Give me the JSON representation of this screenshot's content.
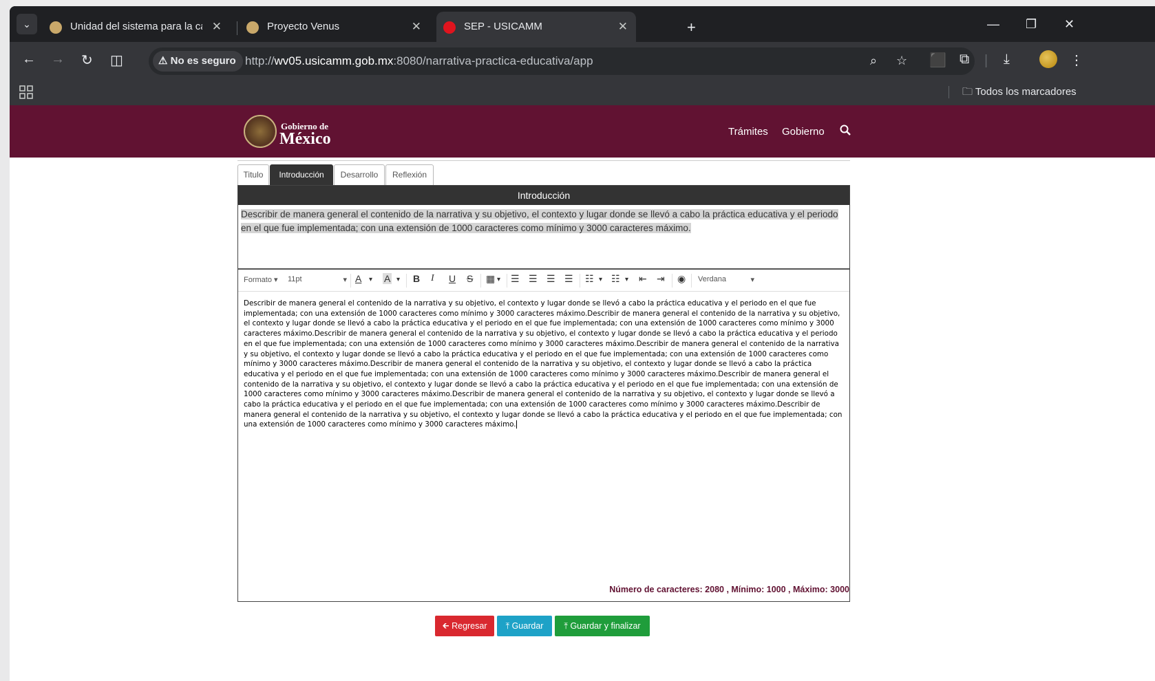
{
  "browser": {
    "tabs": [
      {
        "title": "Unidad del sistema para la carre",
        "favicon_color": "#c9a86a",
        "active": false
      },
      {
        "title": "Proyecto Venus",
        "favicon_color": "#c9a86a",
        "active": false
      },
      {
        "title": "SEP - USICAMM",
        "favicon_color": "#e0141e",
        "active": true
      }
    ],
    "security_label": "No es seguro",
    "url_scheme": "http://",
    "url_host": "wv05.usicamm.gob.mx",
    "url_path": ":8080/narrativa-practica-educativa/app",
    "bookmarks_all": "Todos los marcadores"
  },
  "gob": {
    "logo_small": "Gobierno de",
    "logo_big": "México",
    "nav": [
      "Trámites",
      "Gobierno"
    ]
  },
  "page_tabs": [
    "Titulo",
    "Introducción",
    "Desarrollo",
    "Reflexión"
  ],
  "active_tab_index": 1,
  "section_title": "Introducción",
  "instructions": "Describir de manera general el contenido de la narrativa y su objetivo, el contexto y lugar donde se llevó a cabo la práctica educativa y el periodo en el que fue implementada; con una extensión de 1000 caracteres como mínimo y 3000 caracteres máximo.",
  "editor_toolbar": {
    "format": "Formato",
    "font_size": "11pt",
    "font_family": "Verdana"
  },
  "editor_content": "Describir de manera general el contenido de la narrativa y su objetivo, el contexto y lugar donde se llevó a cabo la práctica educativa y el periodo en el que fue implementada; con una extensión de 1000 caracteres como mínimo y 3000 caracteres máximo.Describir de manera general el contenido de la narrativa y su objetivo, el contexto y lugar donde se llevó a cabo la práctica educativa y el periodo en el que fue implementada; con una extensión de 1000 caracteres como mínimo y 3000 caracteres máximo.Describir de manera general el contenido de la narrativa y su objetivo, el contexto y lugar donde se llevó a cabo la práctica educativa y el periodo en el que fue implementada; con una extensión de 1000 caracteres como mínimo y 3000 caracteres máximo.Describir de manera general el contenido de la narrativa y su objetivo, el contexto y lugar donde se llevó a cabo la práctica educativa y el periodo en el que fue implementada; con una extensión de 1000 caracteres como mínimo y 3000 caracteres máximo.Describir de manera general el contenido de la narrativa y su objetivo, el contexto y lugar donde se llevó a cabo la práctica educativa y el periodo en el que fue implementada; con una extensión de 1000 caracteres como mínimo y 3000 caracteres máximo.Describir de manera general el contenido de la narrativa y su objetivo, el contexto y lugar donde se llevó a cabo la práctica educativa y el periodo en el que fue implementada; con una extensión de 1000 caracteres como mínimo y 3000 caracteres máximo.Describir de manera general el contenido de la narrativa y su objetivo, el contexto y lugar donde se llevó a cabo la práctica educativa y el periodo en el que fue implementada; con una extensión de 1000 caracteres como mínimo y 3000 caracteres máximo.Describir de manera general el contenido de la narrativa y su objetivo, el contexto y lugar donde se llevó a cabo la práctica educativa y el periodo en el que fue implementada; con una extensión de 1000 caracteres como mínimo y 3000 caracteres máximo.",
  "counter_text": "Número de caracteres: 2080 , Mínimo: 1000 , Máximo: 3000",
  "buttons": {
    "back": "Regresar",
    "save": "Guardar",
    "save_finish": "Guardar y finalizar"
  },
  "colors": {
    "gob_maroon": "#611232",
    "btn_red": "#d9282f",
    "btn_blue": "#1ea2c7",
    "btn_green": "#1f9d3b"
  }
}
